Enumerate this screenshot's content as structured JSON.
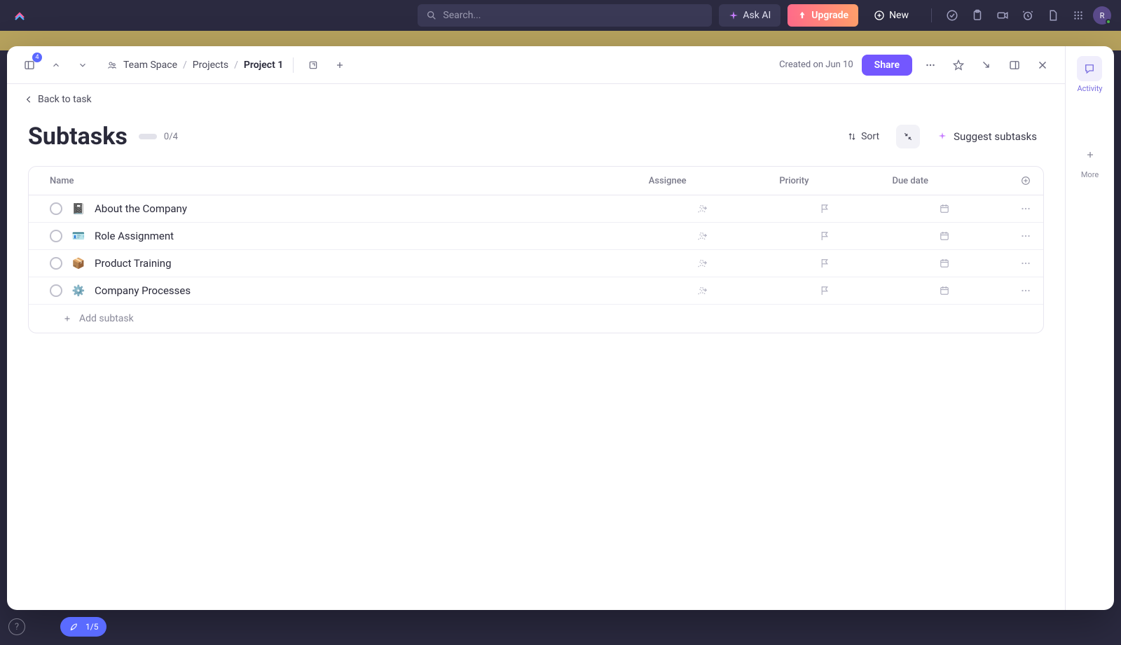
{
  "topnav": {
    "search_placeholder": "Search...",
    "ask_ai": "Ask AI",
    "upgrade": "Upgrade",
    "new": "New",
    "avatar_initial": "R"
  },
  "modal": {
    "header": {
      "book_badge": "4",
      "breadcrumb": {
        "space": "Team Space",
        "folder": "Projects",
        "project": "Project 1"
      },
      "created": "Created on Jun 10",
      "share": "Share"
    },
    "back": "Back to task",
    "title": "Subtasks",
    "progress": "0/4",
    "sort": "Sort",
    "suggest": "Suggest subtasks",
    "columns": {
      "name": "Name",
      "assignee": "Assignee",
      "priority": "Priority",
      "due": "Due date"
    },
    "rows": [
      {
        "emoji": "📓",
        "name": "About the Company"
      },
      {
        "emoji": "🪪",
        "name": "Role Assignment"
      },
      {
        "emoji": "📦",
        "name": "Product Training"
      },
      {
        "emoji": "⚙️",
        "name": "Company Processes"
      }
    ],
    "add_subtask": "Add subtask"
  },
  "rail": {
    "activity": "Activity",
    "more": "More"
  },
  "onboarding": {
    "step": "1/5"
  }
}
